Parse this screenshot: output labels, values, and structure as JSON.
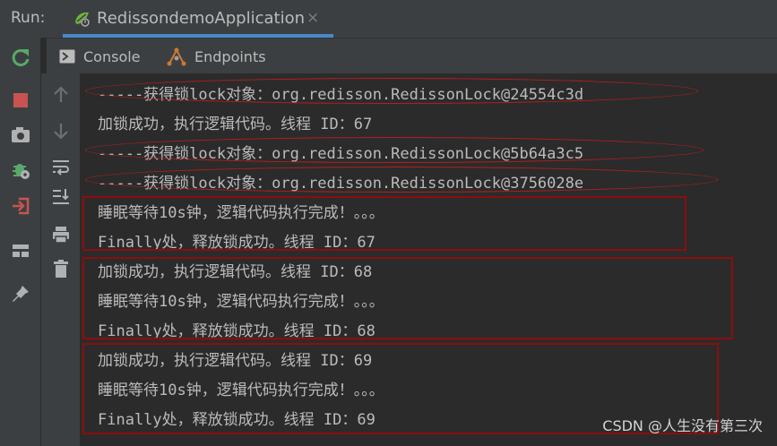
{
  "run_bar": {
    "label": "Run:",
    "tab_title": "RedissondemoApplication",
    "close_glyph": "×"
  },
  "subtabs": [
    {
      "label": "Console",
      "icon": "console-icon"
    },
    {
      "label": "Endpoints",
      "icon": "endpoints-icon"
    }
  ],
  "left_toolbar_icons": [
    "rerun-icon",
    "stop-icon",
    "camera-icon",
    "debug-icon",
    "login-icon",
    "layout-icon",
    "pin-icon"
  ],
  "console_toolbar_icons": [
    "up-arrow-icon",
    "down-arrow-icon",
    "soft-wrap-icon",
    "scroll-to-end-icon",
    "print-icon",
    "trash-icon"
  ],
  "console": {
    "lines": [
      "-----获得锁lock对象：org.redisson.RedissonLock@24554c3d",
      "加锁成功，执行逻辑代码。线程 ID：67",
      "-----获得锁lock对象：org.redisson.RedissonLock@5b64a3c5",
      "-----获得锁lock对象：org.redisson.RedissonLock@3756028e",
      "睡眠等待10s钟，逻辑代码执行完成！。。。",
      "Finally处，释放锁成功。线程 ID：67",
      "加锁成功，执行逻辑代码。线程 ID：68",
      "睡眠等待10s钟，逻辑代码执行完成！。。。",
      "Finally处，释放锁成功。线程 ID：68",
      "加锁成功，执行逻辑代码。线程 ID：69",
      "睡眠等待10s钟，逻辑代码执行完成！。。。",
      "Finally处，释放锁成功。线程 ID：69"
    ]
  },
  "watermark": "CSDN @人生没有第三次",
  "colors": {
    "panel": "#3c3f41",
    "console_bg": "#2b2b2b",
    "text": "#bbbbbb",
    "highlight_ring": "#b71e1e",
    "highlight_box": "#8d0d0d",
    "spring_green": "#6db33f",
    "stop_red": "#c75450"
  }
}
